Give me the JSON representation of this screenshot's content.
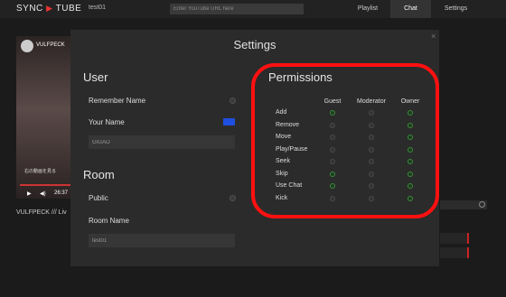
{
  "app": {
    "logo_left": "Sync",
    "logo_arrow": "▶",
    "logo_right": "Tube",
    "room_id": "test01"
  },
  "search": {
    "placeholder": "Enter YouTube URL here"
  },
  "nav": {
    "playlist": "Playlist",
    "chat": "Chat",
    "settings": "Settings"
  },
  "background": {
    "video_title": "VULFPECK",
    "video_jp": "右の動画を見る",
    "time": "26:37",
    "caption": "VULFPECK /// Liv"
  },
  "modal": {
    "title": "Settings",
    "close": "×",
    "user": {
      "heading": "User",
      "remember_name": "Remember Name",
      "your_name": "Your Name",
      "name_value": "GIGAO",
      "color": "#1f4fe0"
    },
    "room": {
      "heading": "Room",
      "public": "Public",
      "room_name_label": "Room Name",
      "room_name_value": "test01"
    },
    "permissions": {
      "heading": "Permissions",
      "columns": [
        "Guest",
        "Moderator",
        "Owner"
      ],
      "rows": [
        {
          "label": "Add",
          "values": [
            true,
            false,
            true
          ]
        },
        {
          "label": "Remove",
          "values": [
            false,
            false,
            true
          ]
        },
        {
          "label": "Move",
          "values": [
            false,
            false,
            true
          ]
        },
        {
          "label": "Play/Pause",
          "values": [
            false,
            false,
            true
          ]
        },
        {
          "label": "Seek",
          "values": [
            false,
            false,
            true
          ]
        },
        {
          "label": "Skip",
          "values": [
            true,
            false,
            true
          ]
        },
        {
          "label": "Use Chat",
          "values": [
            true,
            false,
            true
          ]
        },
        {
          "label": "Kick",
          "values": [
            false,
            false,
            true
          ]
        }
      ]
    }
  },
  "colors": {
    "highlight": "#ff1010",
    "accent_red": "#e33333",
    "checked_green": "#3c8a3c"
  }
}
